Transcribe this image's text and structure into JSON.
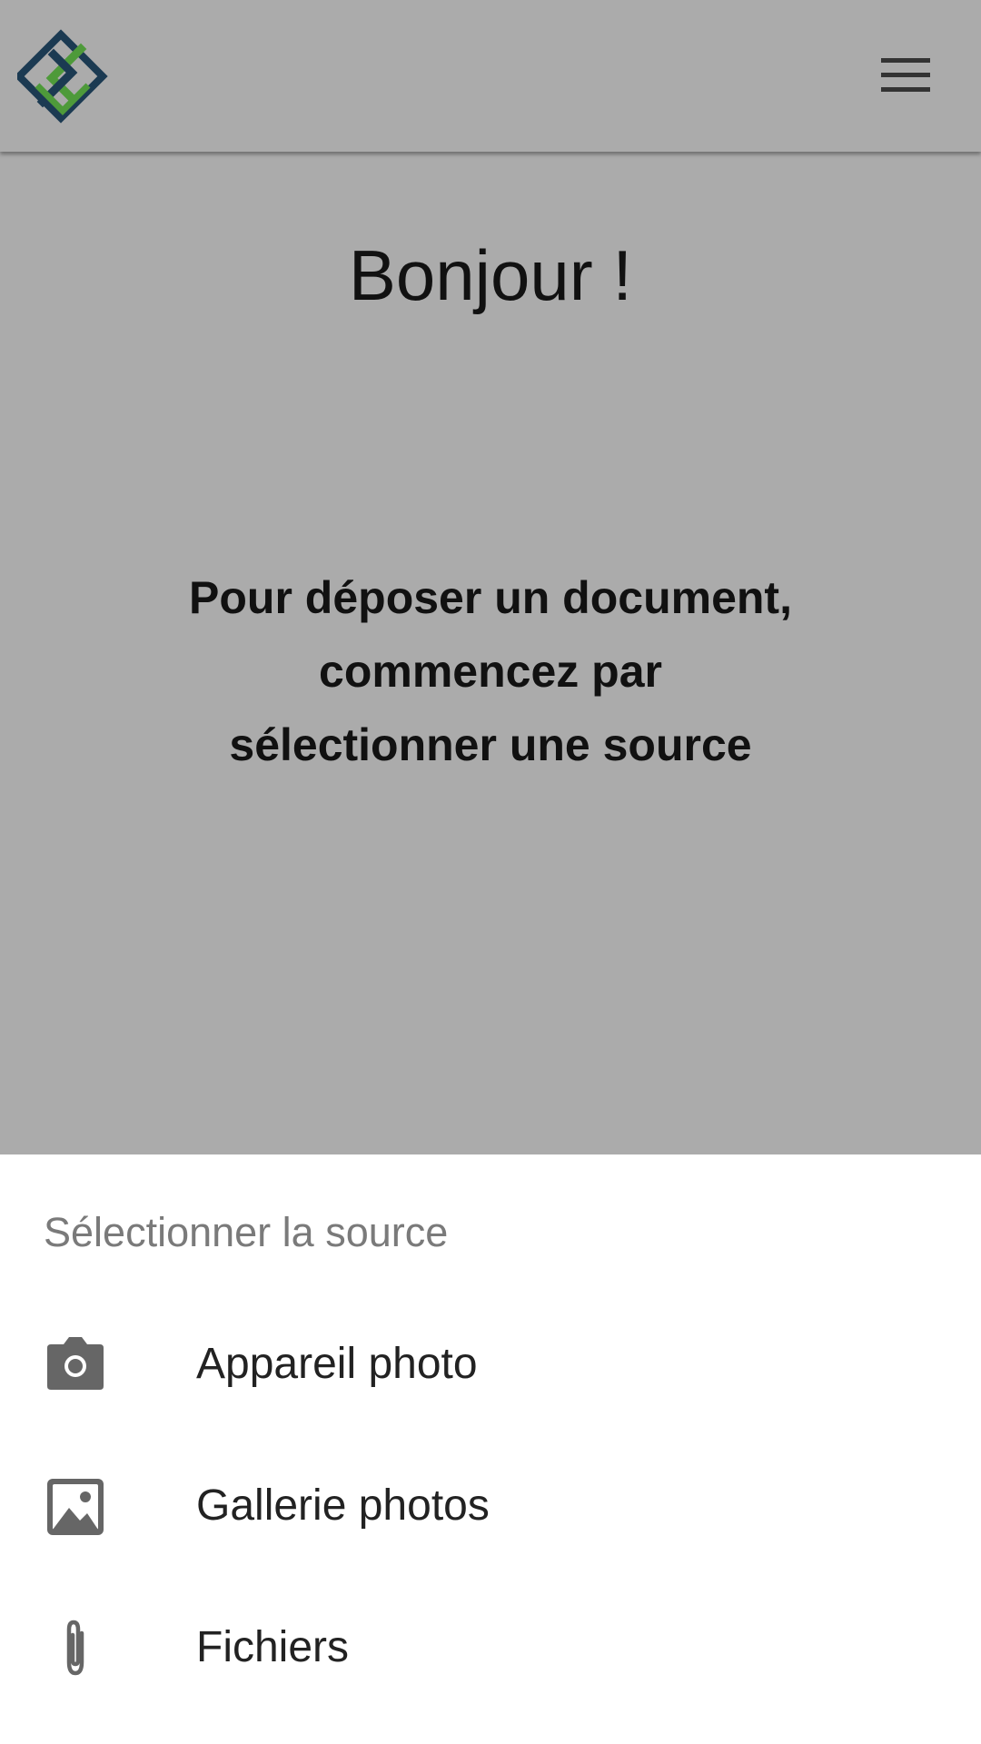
{
  "header": {
    "logo_icon": "app-logo",
    "menu_icon": "hamburger-menu-icon"
  },
  "main": {
    "greeting": "Bonjour !",
    "instruction_lines": [
      "Pour déposer un document,",
      "commencez par",
      "sélectionner une source"
    ]
  },
  "source_sheet": {
    "title": "Sélectionner la source",
    "options": [
      {
        "label": "Appareil photo",
        "icon": "camera-icon"
      },
      {
        "label": "Gallerie photos",
        "icon": "image-icon"
      },
      {
        "label": "Fichiers",
        "icon": "paperclip-icon"
      }
    ]
  },
  "colors": {
    "overlay_background": "#ababab",
    "sheet_background": "#ffffff",
    "logo_navy": "#1b3a52",
    "logo_green": "#4e9a3a",
    "icon_gray": "#666666"
  }
}
